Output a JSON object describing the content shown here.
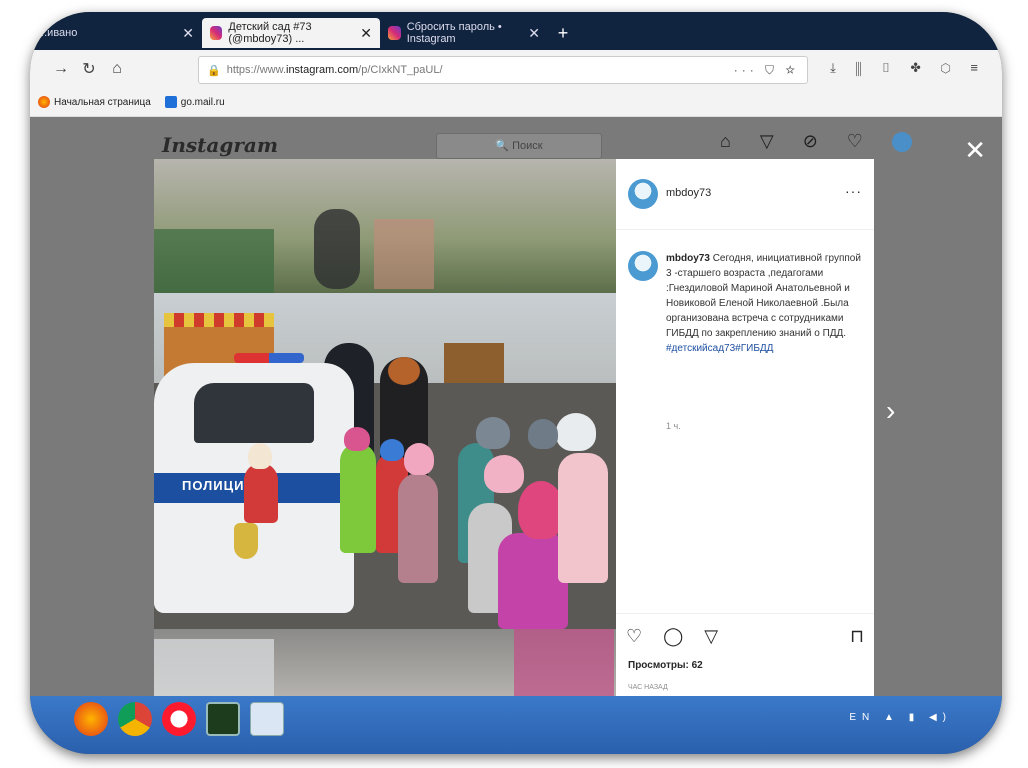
{
  "browser": {
    "tabs": [
      {
        "label": "...ивано",
        "active": false
      },
      {
        "label": "Детский сад #73 (@mbdoy73) ...",
        "active": true
      },
      {
        "label": "Сбросить пароль • Instagram",
        "active": false
      }
    ],
    "new_tab": "+",
    "url": {
      "prefix": "https://www.",
      "domain": "instagram.com",
      "path": "/p/CIxkNT_paUL/"
    },
    "url_actions": "··· ⛉ ☆",
    "toolbar_icons": "⤓ ⫼ ▯ ✤ ⬡ ≡",
    "bookmarks": [
      {
        "label": "Начальная страница"
      },
      {
        "label": "go.mail.ru"
      }
    ]
  },
  "instagram": {
    "logo": "Instagram",
    "search_placeholder": "🔍 Поиск",
    "nav_icons": "⌂ ▽ ⊘ ♡",
    "close": "✕",
    "next": "›",
    "post": {
      "username": "mbdoy73",
      "more": "···",
      "caption_user": "mbdoy73",
      "caption": "Сегодня, инициативной группой 3 -старшего возраста ,педагогами :Гнездиловой Мариной Анатольевной и Новиковой Еленой Николаевной .Была организована встреча с сотрудниками ГИБДД по закреплению знаний о ПДД.",
      "hashtags": "#детскийсад73#ГИБДД",
      "time": "1 ч.",
      "actions": "♡ ◯ ▽",
      "save": "⊓",
      "views": "Просмотры: 62",
      "ago": "ЧАС НАЗАД"
    },
    "photo": {
      "car_label": "ПОЛИЦИЯ"
    }
  },
  "taskbar": {
    "tray": "EN ▲ ▮ ◀)"
  }
}
